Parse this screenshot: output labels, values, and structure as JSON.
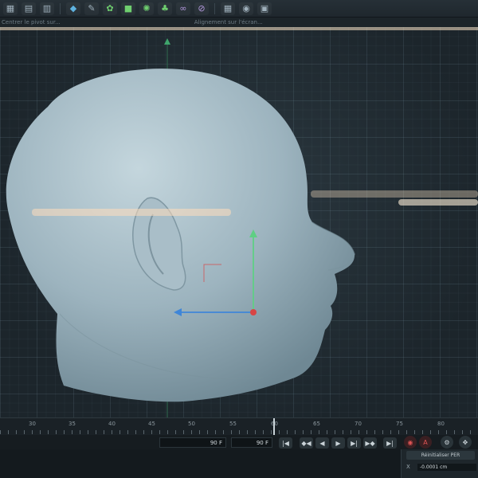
{
  "statusbar": {
    "left_text": "Centrer le pivot sur...",
    "mid_text": "Alignement sur l'écran..."
  },
  "timeline": {
    "ticks": [
      {
        "label": "30"
      },
      {
        "label": "35"
      },
      {
        "label": "40"
      },
      {
        "label": "45"
      },
      {
        "label": "50"
      },
      {
        "label": "55"
      },
      {
        "label": "60"
      },
      {
        "label": "65"
      },
      {
        "label": "70"
      },
      {
        "label": "75"
      },
      {
        "label": "80"
      }
    ]
  },
  "controls": {
    "start_frame": "90 F",
    "end_frame": "90 F"
  },
  "attributes": {
    "reset_label": "Réinitialiser PER",
    "x_label": "X",
    "x_value": "-0.0001 cm"
  },
  "colors": {
    "axis_y": "#5fcf84",
    "axis_x": "#3f86d8",
    "pivot": "#d84545",
    "head": "#9fb7c1"
  }
}
